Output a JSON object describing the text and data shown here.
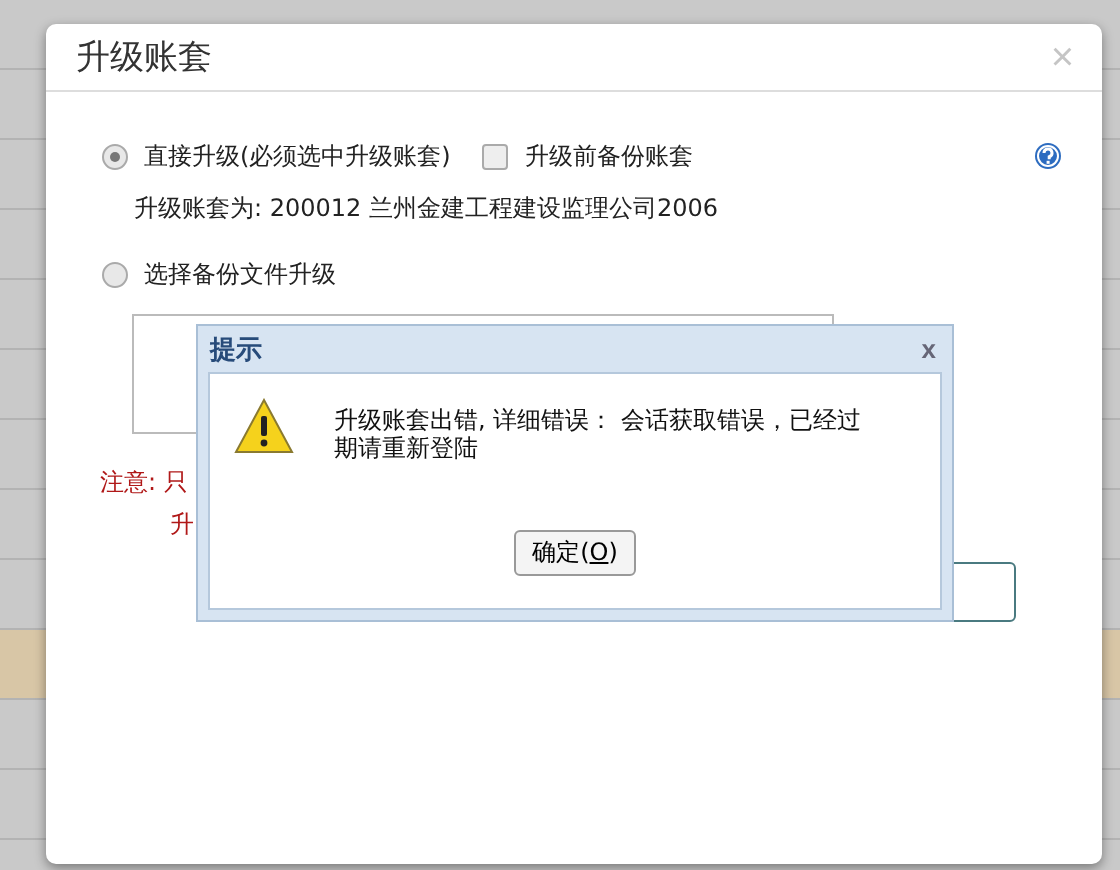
{
  "dialog": {
    "title": "升级账套",
    "close": "×",
    "options": [
      {
        "kind": "radio",
        "label": "直接升级(必须选中升级账套)",
        "selected": true
      },
      {
        "kind": "checkbox",
        "label": "升级前备份账套",
        "checked": false
      }
    ],
    "target_line": "升级账套为: 200012 兰州金建工程建设监理公司2006",
    "option_2": {
      "kind": "radio",
      "label": "选择备份文件升级",
      "selected": false
    },
    "note_lines": [
      "注意: 只",
      "升"
    ]
  },
  "alert": {
    "title": "提示",
    "close": "x",
    "message": "升级账套出错, 详细错误： 会话获取错误，已经过期请重新登陆",
    "button": {
      "label_before": "确定(",
      "hotkey": "O",
      "label_after": ")"
    }
  }
}
